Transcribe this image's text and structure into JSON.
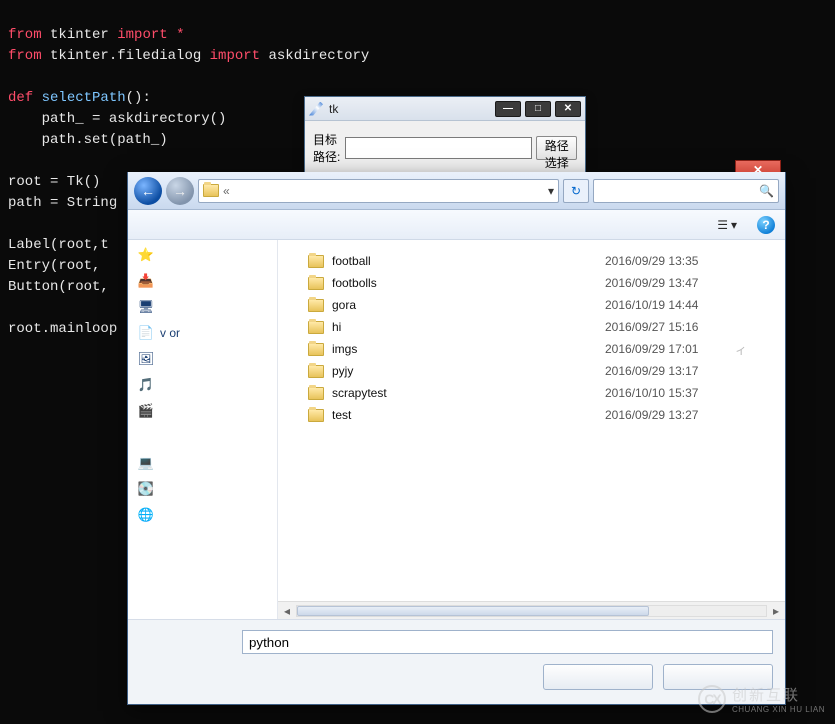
{
  "code": {
    "l1_from": "from",
    "l1_mod": "tkinter",
    "l1_imp": "import",
    "l1_star": "*",
    "l2_from": "from",
    "l2_mod": "tkinter.filedialog",
    "l2_imp": "import",
    "l2_name": "askdirectory",
    "l3_def": "def",
    "l3_fn": "selectPath",
    "l3_rest": "():",
    "l4": "    path_ = askdirectory()",
    "l5": "    path.set(path_)",
    "l6": "root = Tk()",
    "l7": "path = String",
    "l8": "Label(root,t",
    "l9": "Entry(root,",
    "l10": "Button(root,",
    "l11": "root.mainloop"
  },
  "tkwin": {
    "title": "tk",
    "min": "—",
    "max": "□",
    "close": "✕",
    "label": "目标路径:",
    "value": "",
    "placeholder": "",
    "button": "路径选择"
  },
  "dialog": {
    "close_glyph": "✕",
    "back_glyph": "←",
    "fwd_glyph": "→",
    "crumbs_sep": "«",
    "crumbs_dd": "▾",
    "refresh_glyph": "↻",
    "search_placeholder": "",
    "search_glyph": "🔍",
    "toolbar_item1": "",
    "toolbar_item2": "",
    "view_dd": "▾",
    "help_glyph": "?",
    "nav": [
      {
        "glyph": "⭐",
        "label": ""
      },
      {
        "glyph": "📥",
        "label": ""
      },
      {
        "glyph": "🖥",
        "label": ""
      },
      {
        "glyph": "📄",
        "label": "v    or"
      },
      {
        "glyph": "🖼",
        "label": ""
      },
      {
        "glyph": "🎵",
        "label": ""
      },
      {
        "glyph": "🎬",
        "label": ""
      },
      {
        "glyph": "💻",
        "label": ""
      },
      {
        "glyph": "💽",
        "label": ""
      },
      {
        "glyph": "🌐",
        "label": ""
      }
    ],
    "files": [
      {
        "name": "football",
        "date": "2016/09/29 13:35",
        "ext": ""
      },
      {
        "name": "footbolls",
        "date": "2016/09/29 13:47",
        "ext": ""
      },
      {
        "name": "gora",
        "date": "2016/10/19 14:44",
        "ext": ""
      },
      {
        "name": "hi",
        "date": "2016/09/27 15:16",
        "ext": ""
      },
      {
        "name": "imgs",
        "date": "2016/09/29 17:01",
        "ext": "ィ"
      },
      {
        "name": "pyjy",
        "date": "2016/09/29 13:17",
        "ext": ""
      },
      {
        "name": "scrapytest",
        "date": "2016/10/10 15:37",
        "ext": ""
      },
      {
        "name": "test",
        "date": "2016/09/29 13:27",
        "ext": ""
      }
    ],
    "hscroll_left": "◂",
    "hscroll_right": "▸",
    "folder_label": "",
    "folder_value": "python",
    "ok_label": "",
    "cancel_label": ""
  },
  "watermark": {
    "logo": "CX",
    "zh": "创新互联",
    "py": "CHUANG XIN HU LIAN"
  }
}
